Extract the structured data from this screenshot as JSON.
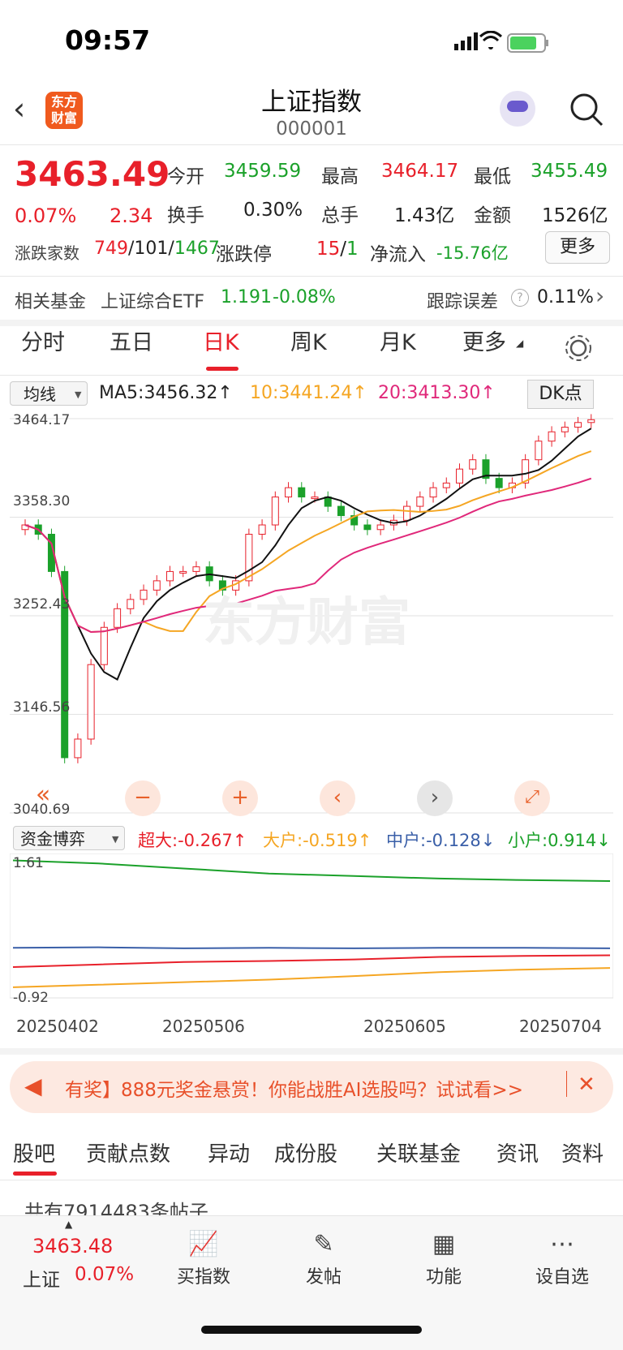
{
  "status_bar": {
    "time": "09:57"
  },
  "header": {
    "title": "上证指数",
    "code": "000001",
    "logo_text": "东方财富"
  },
  "quote": {
    "price": "3463.49",
    "change_pct": "0.07%",
    "change": "2.34",
    "open_label": "今开",
    "open": "3459.59",
    "high_label": "最高",
    "high": "3464.17",
    "low_label": "最低",
    "low": "3455.49",
    "turnover_label": "换手",
    "turnover": "0.30%",
    "volume_label": "总手",
    "volume": "1.43亿",
    "amount_label": "金额",
    "amount": "1526亿",
    "breadth_label": "涨跌家数",
    "up": "749",
    "flat": "101",
    "down": "1467",
    "limit_label": "涨跌停",
    "limit_up": "15",
    "limit_down": "1",
    "netflow_label": "净流入",
    "netflow": "-15.76亿",
    "more_label": "更多"
  },
  "fund": {
    "label": "相关基金",
    "name": "上证综合ETF",
    "price": "1.191",
    "change": "-0.08%",
    "track_label": "跟踪误差",
    "track": "0.11%"
  },
  "chart_tabs": [
    "分时",
    "五日",
    "日K",
    "周K",
    "月K",
    "更多"
  ],
  "active_tab": "日K",
  "ma": {
    "select": "均线",
    "ma5": "MA5:3456.32↑",
    "ma10": "10:3441.24↑",
    "ma20": "20:3413.30↑",
    "dk": "DK点"
  },
  "kline_axis": [
    "3464.17",
    "3358.30",
    "3252.43",
    "3146.56",
    "3040.69"
  ],
  "watermark": "东方财富",
  "capital": {
    "select": "资金博弈",
    "super": "超大:-0.267↑",
    "large": "大户:-0.519↑",
    "mid": "中户:-0.128↓",
    "small": "小户:0.914↓",
    "ymax": "1.61",
    "ymin": "-0.92"
  },
  "dates": [
    "20250402",
    "20250506",
    "20250605",
    "20250704"
  ],
  "banner": {
    "text": "有奖】888元奖金悬赏！你能战胜AI选股吗？试试看>>"
  },
  "bottom_tabs": [
    "股吧",
    "贡献点数",
    "异动",
    "成份股",
    "关联基金",
    "资讯",
    "资料"
  ],
  "posts_text": "共有7914483条帖子",
  "footer": {
    "price": "3463.48",
    "name": "上证",
    "pct": "0.07%",
    "buy": "买指数",
    "post": "发帖",
    "func": "功能",
    "watch": "设自选"
  },
  "chart_data": {
    "type": "candlestick",
    "title": "上证指数 日K",
    "ylim": [
      3040.69,
      3464.17
    ],
    "x": [
      "20250402",
      "20250506",
      "20250605",
      "20250704"
    ],
    "close_approx": [
      3350,
      3340,
      3300,
      3100,
      3120,
      3200,
      3240,
      3260,
      3270,
      3280,
      3290,
      3300,
      3300,
      3305,
      3290,
      3280,
      3290,
      3340,
      3350,
      3380,
      3390,
      3380,
      3380,
      3370,
      3360,
      3350,
      3345,
      3350,
      3355,
      3370,
      3380,
      3390,
      3395,
      3410,
      3420,
      3400,
      3390,
      3395,
      3420,
      3440,
      3450,
      3455,
      3460,
      3463
    ],
    "capital_lines": [
      {
        "name": "小户",
        "values": [
          1.61,
          1.55,
          1.45,
          1.35,
          1.3,
          1.25,
          1.22,
          1.2
        ]
      },
      {
        "name": "中户",
        "values": [
          -0.12,
          -0.11,
          -0.13,
          -0.12,
          -0.13,
          -0.12,
          -0.12,
          -0.13
        ]
      },
      {
        "name": "超大",
        "values": [
          -0.5,
          -0.45,
          -0.4,
          -0.38,
          -0.35,
          -0.3,
          -0.28,
          -0.267
        ]
      },
      {
        "name": "大户",
        "values": [
          -0.9,
          -0.85,
          -0.8,
          -0.75,
          -0.68,
          -0.6,
          -0.55,
          -0.519
        ]
      }
    ]
  }
}
